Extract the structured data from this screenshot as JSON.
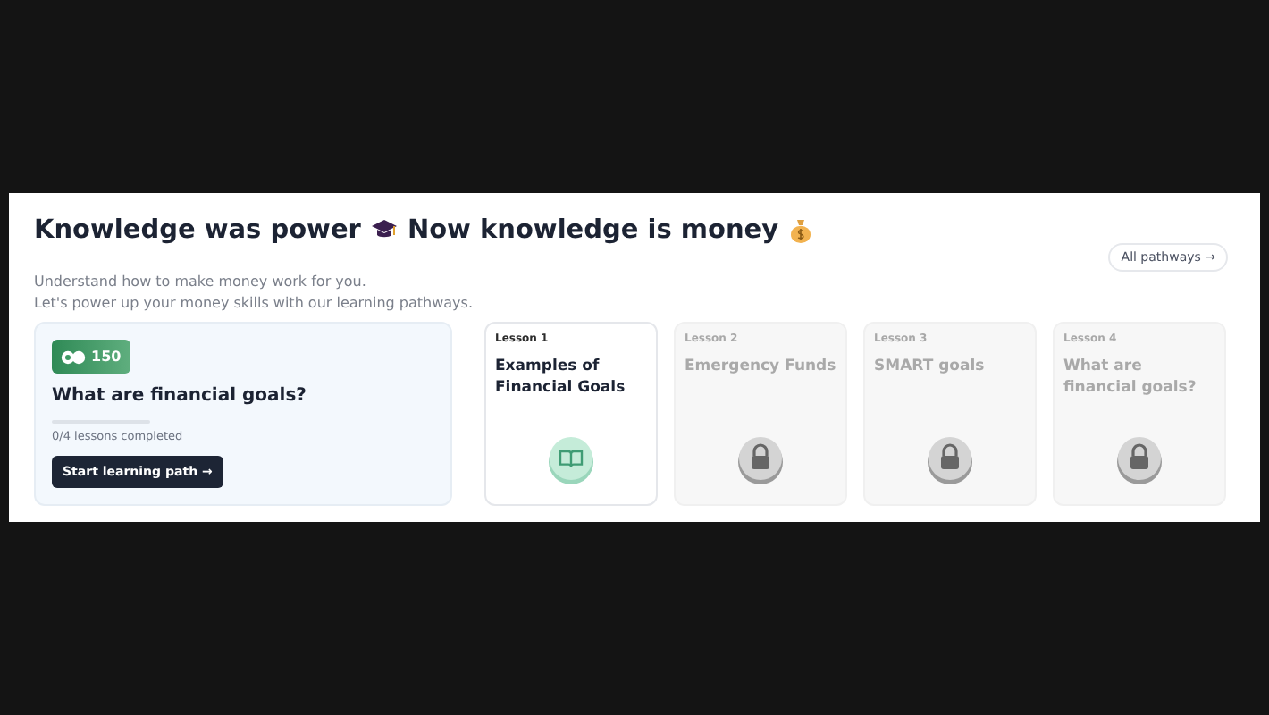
{
  "header": {
    "title_part_1": "Knowledge was power",
    "title_part_2": "Now knowledge is money",
    "subtitle_lines": [
      "Understand how to make money work for you.",
      "Let's power up your money skills with our learning pathways."
    ],
    "all_pathways_link": "All pathways →"
  },
  "pathway": {
    "points": "150",
    "title": "What are financial goals?",
    "progress": {
      "level": 0
    },
    "progress_text": "0/4 lessons completed",
    "start_button": "Start learning path →"
  },
  "lessons": [
    {
      "label": "Lesson 1",
      "title": "Examples of Financial Goals",
      "locked": false
    },
    {
      "label": "Lesson 2",
      "title": "Emergency Funds",
      "locked": true
    },
    {
      "label": "Lesson 3",
      "title": "SMART goals",
      "locked": true
    },
    {
      "label": "Lesson 4",
      "title": "What are financial goals?",
      "locked": true
    }
  ]
}
